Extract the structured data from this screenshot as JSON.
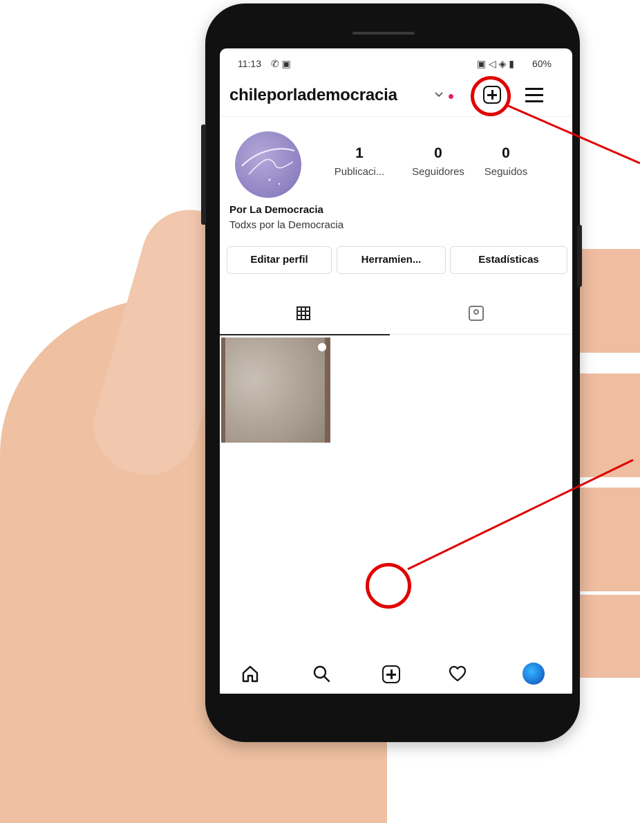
{
  "status_bar": {
    "time": "11:13",
    "left_icons": "✆ ▣",
    "right_icons": "▣ ◁ ◈ ▮",
    "battery": "60%"
  },
  "header": {
    "username": "chileporlademocracia",
    "chevron_icon": "chevron-down-icon",
    "new_post_icon": "plus-square-icon",
    "menu_icon": "menu-icon"
  },
  "profile": {
    "stats": [
      {
        "value": "1",
        "label": "Publicaci..."
      },
      {
        "value": "0",
        "label": "Seguidores"
      },
      {
        "value": "0",
        "label": "Seguidos"
      }
    ],
    "display_name": "Por La Democracia",
    "bio": "Todxs por la Democracia",
    "buttons": {
      "edit": "Editar perfil",
      "tools": "Herramien...",
      "insights": "Estadísticas"
    }
  },
  "tabs": {
    "grid_icon": "grid-icon",
    "tagged_icon": "tagged-photo-icon"
  },
  "bottom_nav": {
    "items": [
      "home-icon",
      "search-icon",
      "plus-square-icon",
      "heart-icon",
      "profile-avatar"
    ]
  },
  "annotation": {
    "color": "#e00000"
  },
  "colors": {
    "notification_dot": "#e0245e",
    "avatar": "#8f82c2"
  }
}
